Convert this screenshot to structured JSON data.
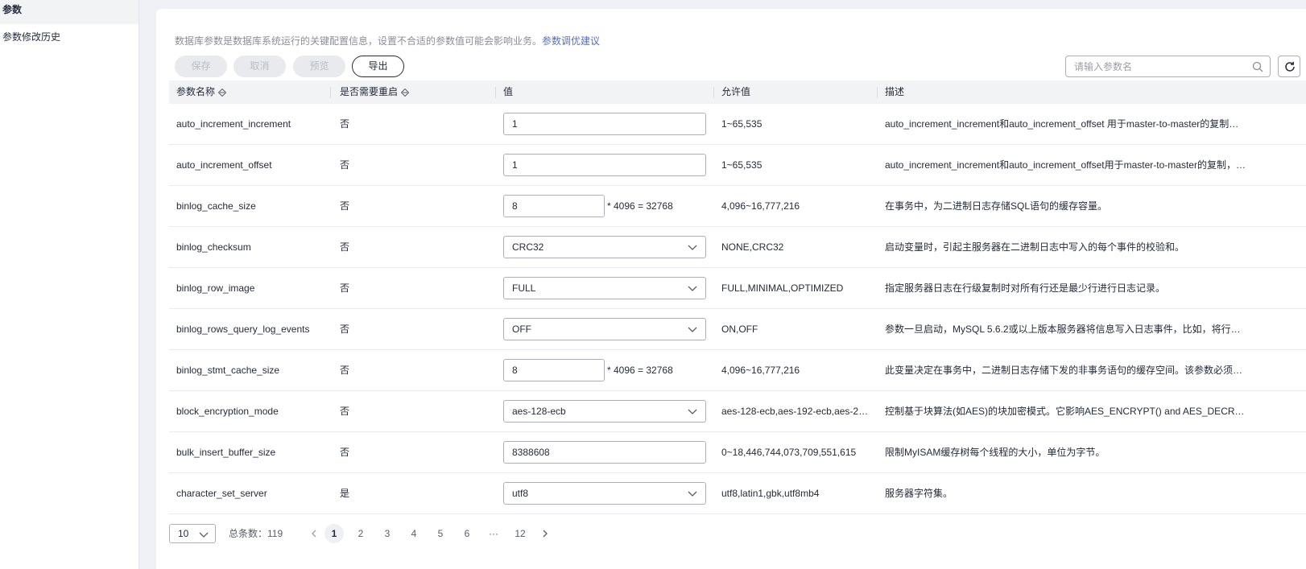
{
  "sidebar": {
    "items": [
      {
        "label": "参数"
      },
      {
        "label": "参数修改历史"
      }
    ]
  },
  "notice": {
    "text": "数据库参数是数据库系统运行的关键配置信息，设置不合适的参数值可能会影响业务。",
    "link": "参数调优建议"
  },
  "toolbar": {
    "save_label": "保存",
    "cancel_label": "取消",
    "preview_label": "预览",
    "export_label": "导出",
    "search_placeholder": "请输入参数名"
  },
  "table": {
    "headers": {
      "name": "参数名称",
      "restart": "是否需要重启",
      "value": "值",
      "allowed": "允许值",
      "desc": "描述"
    },
    "rows": [
      {
        "name": "auto_increment_increment",
        "restart": "否",
        "value": "1",
        "allowed": "1~65,535",
        "desc": "auto_increment_increment和auto_increment_offset 用于master-to-master的复制，并..."
      },
      {
        "name": "auto_increment_offset",
        "restart": "否",
        "value": "1",
        "allowed": "1~65,535",
        "desc": "auto_increment_increment和auto_increment_offset用于master-to-master的复制，并..."
      },
      {
        "name": "binlog_cache_size",
        "restart": "否",
        "value": "8",
        "mult": "* 4096 = 32768",
        "allowed": "4,096~16,777,216",
        "desc": "在事务中，为二进制日志存储SQL语句的缓存容量。"
      },
      {
        "name": "binlog_checksum",
        "restart": "否",
        "value": "CRC32",
        "allowed": "NONE,CRC32",
        "desc": "启动变量时，引起主服务器在二进制日志中写入的每个事件的校验和。"
      },
      {
        "name": "binlog_row_image",
        "restart": "否",
        "value": "FULL",
        "allowed": "FULL,MINIMAL,OPTIMIZED",
        "desc": "指定服务器日志在行级复制时对所有行还是最少行进行日志记录。"
      },
      {
        "name": "binlog_rows_query_log_events",
        "restart": "否",
        "value": "OFF",
        "allowed": "ON,OFF",
        "desc": "参数一旦启动，MySQL 5.6.2或以上版本服务器将信息写入日志事件，比如，将行日志..."
      },
      {
        "name": "binlog_stmt_cache_size",
        "restart": "否",
        "value": "8",
        "mult": "* 4096 = 32768",
        "allowed": "4,096~16,777,216",
        "desc": "此变量决定在事务中，二进制日志存储下发的非事务语句的缓存空间。该参数必须设置..."
      },
      {
        "name": "block_encryption_mode",
        "restart": "否",
        "value": "aes-128-ecb",
        "allowed": "aes-128-ecb,aes-192-ecb,aes-25...",
        "desc": "控制基于块算法(如AES)的块加密模式。它影响AES_ENCRYPT() and AES_DECRYPT..."
      },
      {
        "name": "bulk_insert_buffer_size",
        "restart": "否",
        "value": "8388608",
        "allowed": "0~18,446,744,073,709,551,615",
        "desc": "限制MyISAM缓存树每个线程的大小，单位为字节。"
      },
      {
        "name": "character_set_server",
        "restart": "是",
        "value": "utf8",
        "allowed": "utf8,latin1,gbk,utf8mb4",
        "desc": "服务器字符集。"
      }
    ]
  },
  "pagination": {
    "page_size": "10",
    "total": "总条数：119",
    "pages": [
      "1",
      "2",
      "3",
      "4",
      "5",
      "6",
      "···",
      "12"
    ],
    "current": "1"
  }
}
